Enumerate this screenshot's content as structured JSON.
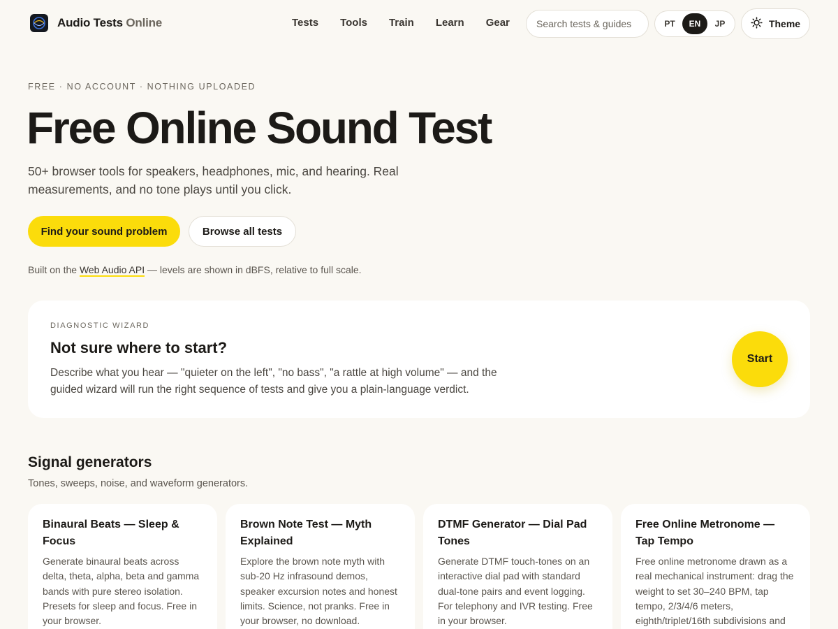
{
  "header": {
    "brand_main": "Audio Tests",
    "brand_light": "Online",
    "nav": [
      "Tests",
      "Tools",
      "Train",
      "Learn",
      "Gear"
    ],
    "search_placeholder": "Search tests & guides",
    "languages": [
      "PT",
      "EN",
      "JP"
    ],
    "active_language": "EN",
    "theme_label": "Theme"
  },
  "hero": {
    "eyebrow": "FREE · NO ACCOUNT · NOTHING UPLOADED",
    "title": "Free Online Sound Test",
    "subtitle": "50+ browser tools for speakers, headphones, mic, and hearing. Real measurements, and no tone plays until you click.",
    "primary_cta": "Find your sound problem",
    "secondary_cta": "Browse all tests",
    "built_on_prefix": "Built on the ",
    "built_on_link": "Web Audio API",
    "built_on_suffix": " — levels are shown in dBFS, relative to full scale."
  },
  "wizard": {
    "eyebrow": "DIAGNOSTIC WIZARD",
    "title": "Not sure where to start?",
    "description": "Describe what you hear — \"quieter on the left\", \"no bass\", \"a rattle at high volume\" — and the guided wizard will run the right sequence of tests and give you a plain-language verdict.",
    "start_label": "Start"
  },
  "section": {
    "title": "Signal generators",
    "subtitle": "Tones, sweeps, noise, and waveform generators.",
    "cards": [
      {
        "title": "Binaural Beats — Sleep & Focus",
        "description": "Generate binaural beats across delta, theta, alpha, beta and gamma bands with pure stereo isolation. Presets for sleep and focus. Free in your browser."
      },
      {
        "title": "Brown Note Test — Myth Explained",
        "description": "Explore the brown note myth with sub-20 Hz infrasound demos, speaker excursion notes and honest limits. Science, not pranks. Free in your browser, no download."
      },
      {
        "title": "DTMF Generator — Dial Pad Tones",
        "description": "Generate DTMF touch-tones on an interactive dial pad with standard dual-tone pairs and event logging. For telephony and IVR testing. Free in your browser."
      },
      {
        "title": "Free Online Metronome — Tap Tempo",
        "description": "Free online metronome drawn as a real mechanical instrument: drag the weight to set 30–240 BPM, tap tempo, 2/3/4/6 meters, eighth/triplet/16th subdivisions and"
      }
    ]
  },
  "colors": {
    "accent": "#fbdc0b",
    "background": "#faf8f3",
    "text": "#1c1a17"
  }
}
